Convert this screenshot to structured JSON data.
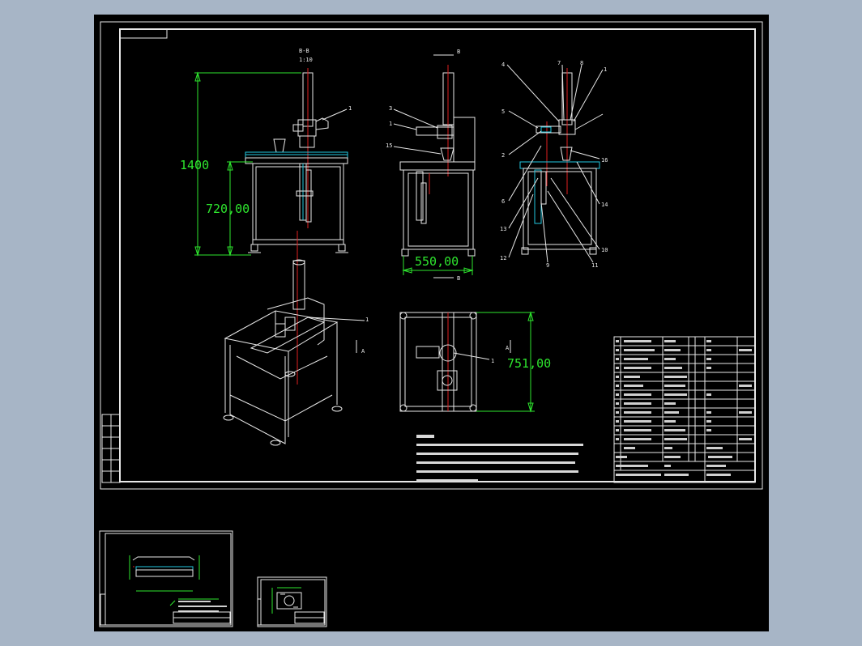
{
  "drawing": {
    "dim_height_total": "1400",
    "dim_height_table": "720,00",
    "dim_width": "550,00",
    "dim_depth": "751,00",
    "section_label": "B-B",
    "section_scale": "1:10",
    "section_mark": "B",
    "view_mark": "A",
    "balloons_front": [
      "1"
    ],
    "balloons_side": [
      "3",
      "1",
      "15"
    ],
    "balloons_right": [
      "4",
      "7",
      "8",
      "1",
      "5",
      "2",
      "16",
      "6",
      "14",
      "13",
      "10",
      "12",
      "9",
      "11"
    ],
    "balloon_iso": "1",
    "balloon_top": "1"
  },
  "colors": {
    "sheet_bg": "#000000",
    "line_white": "#e8e8e8",
    "dim_green": "#2ee62e",
    "axis_red": "#e02020",
    "cyan": "#22c8e0",
    "outer_bg": "#a7b5c6"
  }
}
